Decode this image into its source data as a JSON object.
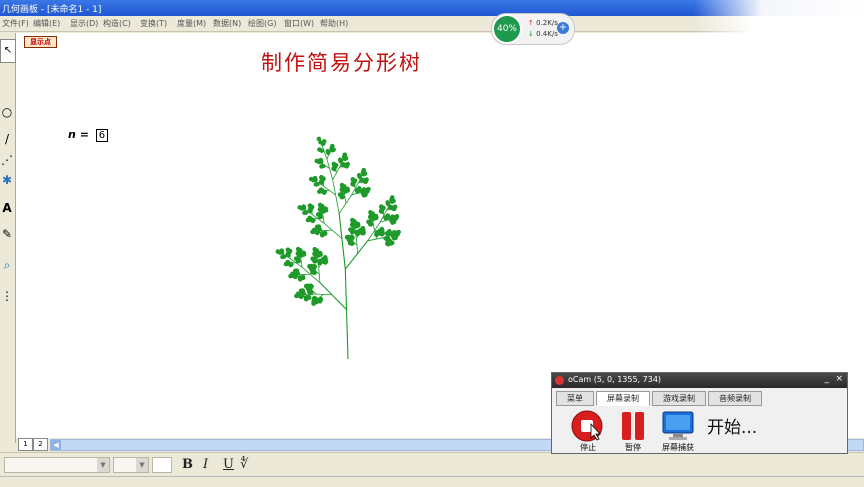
{
  "window": {
    "title": "几何画板 - [未命名1 - 1]"
  },
  "menu": {
    "items": [
      "文件(F)",
      "编辑(E)",
      "显示(D)",
      "构造(C)",
      "变换(T)",
      "度量(M)",
      "数据(N)",
      "绘图(G)",
      "窗口(W)",
      "帮助(H)"
    ]
  },
  "canvas": {
    "show_button": "显示点",
    "title": "制作简易分形树",
    "param_label": "n",
    "param_equals": "=",
    "param_value": "6"
  },
  "pages": [
    "1",
    "2"
  ],
  "format_bar": {
    "bold": "B",
    "italic": "I",
    "underline": "U"
  },
  "cpu_widget": {
    "percent": "40%",
    "upload": "0.2K/s",
    "download": "0.4K/s"
  },
  "ocam": {
    "title": "oCam (5, 0, 1355, 734)",
    "tabs": [
      "菜单",
      "屏幕录制",
      "游戏录制",
      "音频录制"
    ],
    "active_tab": "屏幕录制",
    "buttons": {
      "stop": "停止",
      "pause": "暂停",
      "capture": "屏幕捕获"
    },
    "status": "开始..."
  },
  "colors": {
    "title_red": "#c01010",
    "tree_green": "#1a9a2a",
    "titlebar_blue": "#2a62dc"
  }
}
